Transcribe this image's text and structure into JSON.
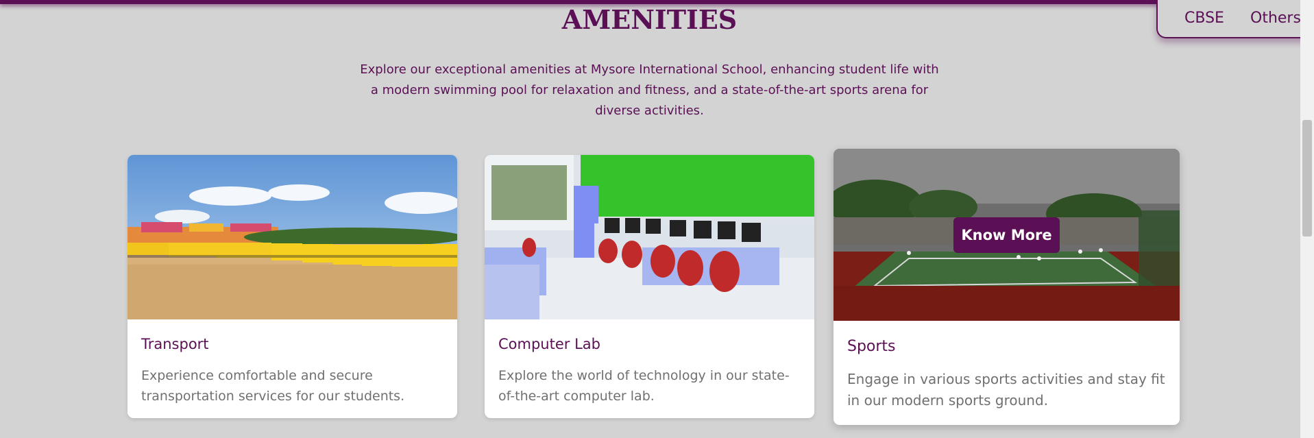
{
  "nav": {
    "items": [
      "CBSE",
      "Others"
    ]
  },
  "section": {
    "title": "AMENITIES",
    "intro": "Explore our exceptional amenities at Mysore International School, enhancing student life with a modern swimming pool for relaxation and fitness, and a state-of-the-art sports arena for diverse activities."
  },
  "cards": [
    {
      "title": "Transport",
      "description": "Experience comfortable and secure transportation services for our students."
    },
    {
      "title": "Computer Lab",
      "description": "Explore the world of technology in our state-of-the-art computer lab."
    },
    {
      "title": "Sports",
      "description": "Engage in various sports activities and stay fit in our modern sports ground.",
      "button": "Know More"
    }
  ],
  "colors": {
    "accent": "#5b0f55",
    "background": "#d3d3d3",
    "card": "#ffffff"
  }
}
